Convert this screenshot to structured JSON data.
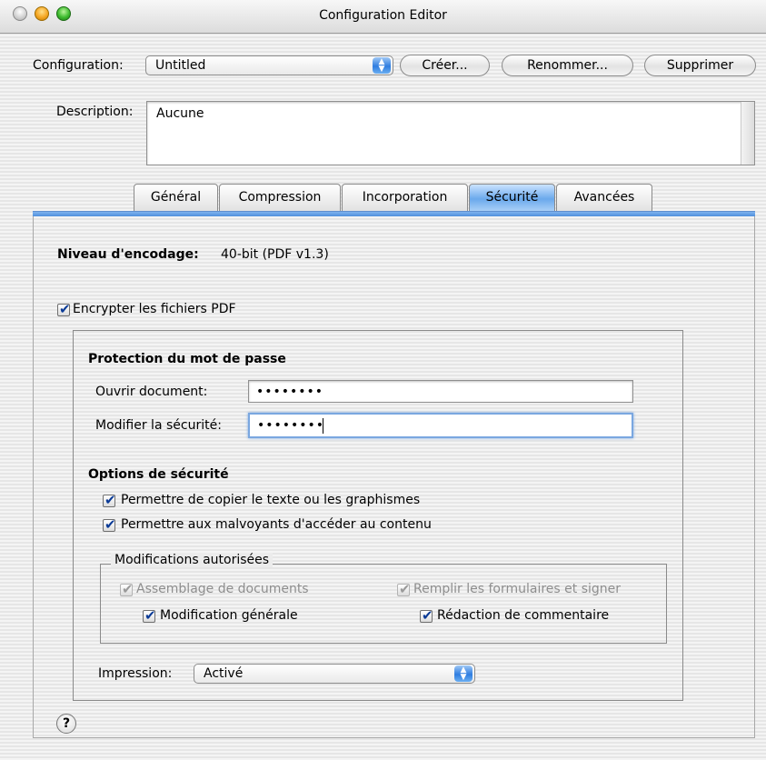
{
  "window": {
    "title": "Configuration Editor"
  },
  "config": {
    "label": "Configuration:",
    "selected": "Untitled",
    "buttons": {
      "create": "Créer...",
      "rename": "Renommer...",
      "delete": "Supprimer"
    }
  },
  "description": {
    "label": "Description:",
    "value": "Aucune"
  },
  "tabs": [
    {
      "label": "Général"
    },
    {
      "label": "Compression"
    },
    {
      "label": "Incorporation"
    },
    {
      "label": "Sécurité"
    },
    {
      "label": "Avancées"
    }
  ],
  "security": {
    "encoding_label": "Niveau d'encodage:",
    "encoding_value": "40-bit (PDF v1.3)",
    "encrypt_label": "Encrypter les fichiers PDF",
    "password_section": "Protection du mot de passe",
    "open_label": "Ouvrir document:",
    "open_value": "••••••••",
    "modify_label": "Modifier la sécurité:",
    "modify_value": "••••••••",
    "options_section": "Options de sécurité",
    "copy_label": "Permettre de copier le texte ou les graphismes",
    "access_label": "Permettre aux malvoyants d'accéder au contenu",
    "mods_title": "Modifications autorisées",
    "assembly_label": "Assemblage de documents",
    "forms_label": "Remplir les formulaires et signer",
    "general_label": "Modification générale",
    "comments_label": "Rédaction de commentaire",
    "print_label": "Impression:",
    "print_value": "Activé"
  },
  "help": {
    "glyph": "?"
  },
  "glyphs": {
    "check": "✔",
    "up_down": "▲▼"
  }
}
